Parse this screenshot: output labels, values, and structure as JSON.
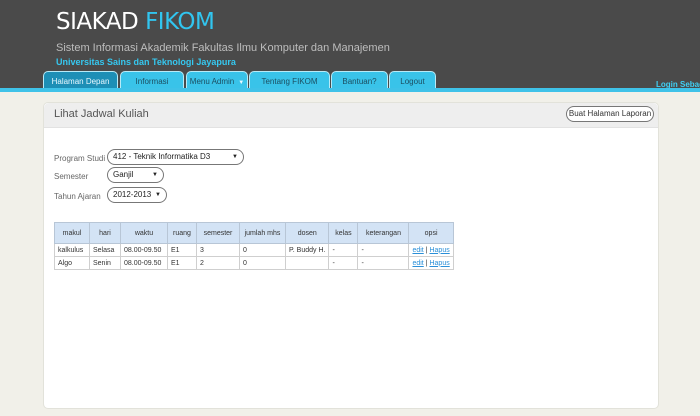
{
  "header": {
    "brand_main": "SIAKAD",
    "brand_accent": "FIKOM",
    "subtitle": "Sistem Informasi Akademik Fakultas Ilmu Komputer dan Manajemen",
    "university": "Universitas Sains dan Teknologi Jayapura",
    "login_text": "Login Sebagai",
    "accent_color": "#3fc2e8"
  },
  "nav": {
    "tabs": [
      {
        "label": "Halaman Depan",
        "active": true
      },
      {
        "label": "Informasi"
      },
      {
        "label": "Menu Admin",
        "has_dropdown": true
      },
      {
        "label": "Tentang FIKOM"
      },
      {
        "label": "Bantuan?"
      },
      {
        "label": "Logout"
      }
    ]
  },
  "panel": {
    "title": "Lihat Jadwal Kuliah",
    "report_button": "Buat Halaman Laporan"
  },
  "filters": {
    "program_label": "Program Studi",
    "program_value": "412 - Teknik Informatika D3",
    "semester_label": "Semester",
    "semester_value": "Ganjil",
    "year_label": "Tahun Ajaran",
    "year_value": "2012-2013"
  },
  "table": {
    "headers": [
      "makul",
      "hari",
      "waktu",
      "ruang",
      "semester",
      "jumlah mhs",
      "dosen",
      "kelas",
      "keterangan",
      "opsi"
    ],
    "rows": [
      {
        "makul": "kalkulus",
        "hari": "Selasa",
        "waktu": "08.00-09.50",
        "ruang": "E1",
        "semester": "3",
        "jumlah": "0",
        "dosen": "P. Buddy H.",
        "kelas": "-",
        "keterangan": "-",
        "edit": "edit",
        "sep": "|",
        "hapus": "Hapus"
      },
      {
        "makul": "Algo",
        "hari": "Senin",
        "waktu": "08.00-09.50",
        "ruang": "E1",
        "semester": "2",
        "jumlah": "0",
        "dosen": "",
        "kelas": "-",
        "keterangan": "-",
        "edit": "edit",
        "sep": "|",
        "hapus": "Hapus"
      }
    ]
  }
}
